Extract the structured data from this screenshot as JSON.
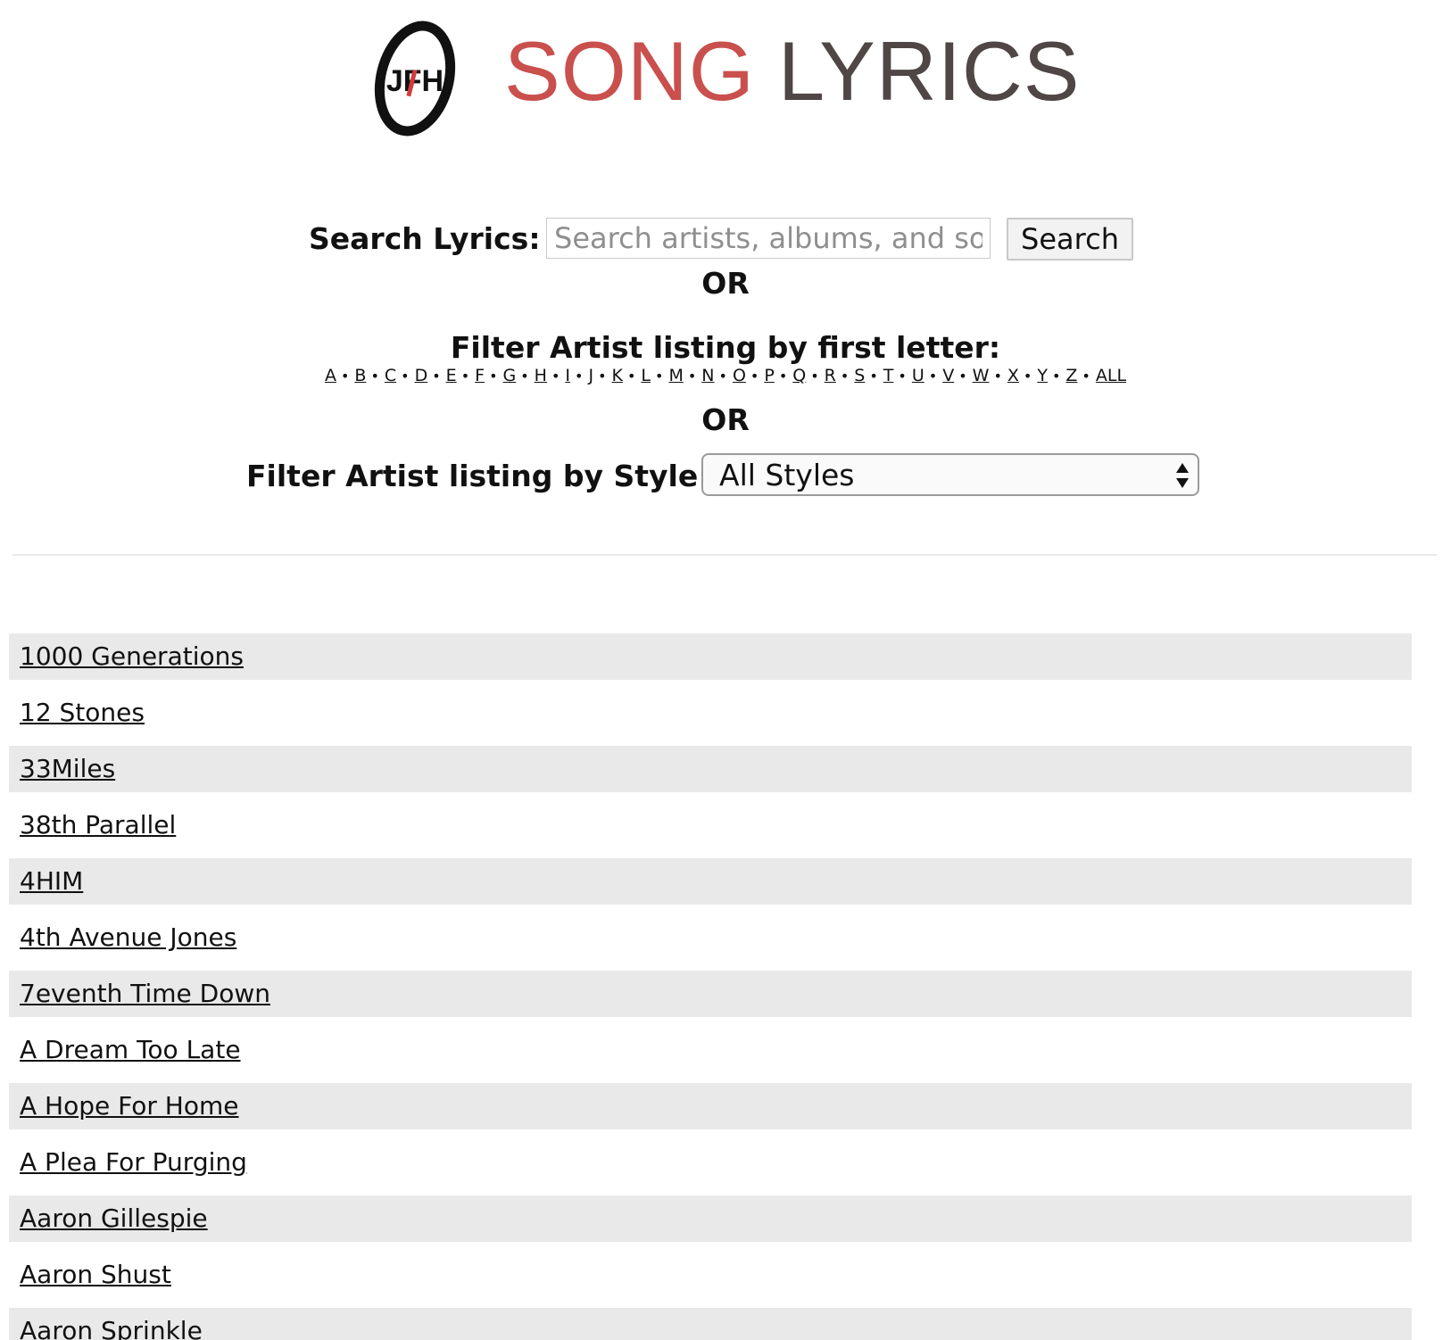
{
  "header": {
    "logo_mark_text": "JFH",
    "logo_word1": "SONG",
    "logo_word2": "LYRICS",
    "logo_word1_color": "#c9504d",
    "logo_word2_color": "#4f4646"
  },
  "search": {
    "label": "Search Lyrics:",
    "placeholder": "Search artists, albums, and songs",
    "button_label": "Search"
  },
  "or_text": "OR",
  "letter_filter": {
    "heading": "Filter Artist listing by first letter:",
    "letters": [
      "A",
      "B",
      "C",
      "D",
      "E",
      "F",
      "G",
      "H",
      "I",
      "J",
      "K",
      "L",
      "M",
      "N",
      "O",
      "P",
      "Q",
      "R",
      "S",
      "T",
      "U",
      "V",
      "W",
      "X",
      "Y",
      "Z",
      "ALL"
    ],
    "separator": "•"
  },
  "style_filter": {
    "label": "Filter Artist listing by Style:",
    "selected": "All Styles"
  },
  "artists": [
    "1000 Generations",
    "12 Stones",
    "33Miles",
    "38th Parallel",
    "4HIM",
    "4th Avenue Jones",
    "7eventh Time Down",
    "A Dream Too Late",
    "A Hope For Home",
    "A Plea For Purging",
    "Aaron Gillespie",
    "Aaron Shust",
    "Aaron Sprinkle"
  ],
  "colors": {
    "row_shade": "#e9e9e9",
    "divider": "#e9e9e9"
  }
}
